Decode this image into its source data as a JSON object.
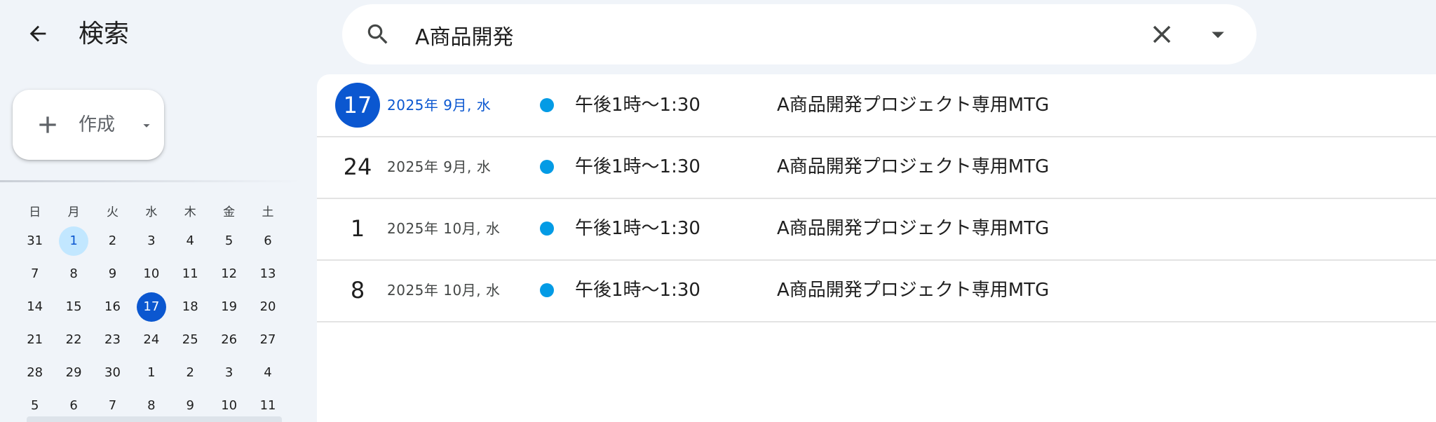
{
  "header": {
    "back_icon": "arrow-left-icon",
    "title": "検索"
  },
  "search": {
    "value": "A商品開発",
    "search_icon": "search-icon",
    "clear_icon": "close-icon",
    "options_icon": "caret-down-icon"
  },
  "create": {
    "label": "作成",
    "plus_icon": "plus-icon",
    "caret_icon": "caret-down-icon"
  },
  "mini_calendar": {
    "weekdays": [
      "日",
      "月",
      "火",
      "水",
      "木",
      "金",
      "土"
    ],
    "weeks": [
      [
        "31",
        "1",
        "2",
        "3",
        "4",
        "5",
        "6"
      ],
      [
        "7",
        "8",
        "9",
        "10",
        "11",
        "12",
        "13"
      ],
      [
        "14",
        "15",
        "16",
        "17",
        "18",
        "19",
        "20"
      ],
      [
        "21",
        "22",
        "23",
        "24",
        "25",
        "26",
        "27"
      ],
      [
        "28",
        "29",
        "30",
        "1",
        "2",
        "3",
        "4"
      ],
      [
        "5",
        "6",
        "7",
        "8",
        "9",
        "10",
        "11"
      ]
    ],
    "today": "1",
    "selected": "17",
    "colors": {
      "today_bg": "#c2e7ff",
      "selected_bg": "#0b57d0"
    }
  },
  "results": [
    {
      "day": "17",
      "meta": "2025年 9月, 水",
      "time": "午後1時～1:30",
      "title": "A商品開発プロジェクト専用MTG",
      "highlight": true
    },
    {
      "day": "24",
      "meta": "2025年 9月, 水",
      "time": "午後1時～1:30",
      "title": "A商品開発プロジェクト専用MTG",
      "highlight": false
    },
    {
      "day": "1",
      "meta": "2025年 10月, 水",
      "time": "午後1時～1:30",
      "title": "A商品開発プロジェクト専用MTG",
      "highlight": false
    },
    {
      "day": "8",
      "meta": "2025年 10月, 水",
      "time": "午後1時～1:30",
      "title": "A商品開発プロジェクト専用MTG",
      "highlight": false
    }
  ],
  "colors": {
    "background": "#f0f4f9",
    "accent": "#0b57d0",
    "event_dot": "#039be5"
  }
}
